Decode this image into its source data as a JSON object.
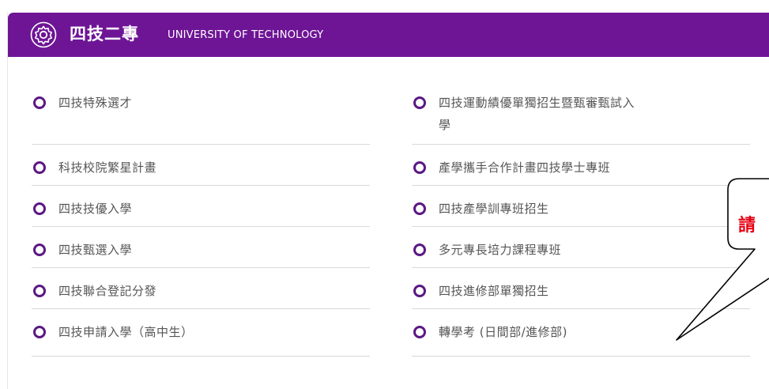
{
  "header": {
    "title": "四技二專",
    "subtitle": "UNIVERSITY OF TECHNOLOGY",
    "icon": "gear-settings-icon",
    "bg_color": "#6e1596"
  },
  "left_items": [
    {
      "label": "四技特殊選才"
    },
    {
      "label": "科技校院繁星計畫"
    },
    {
      "label": "四技技優入學"
    },
    {
      "label": "四技甄選入學"
    },
    {
      "label": "四技聯合登記分發"
    },
    {
      "label": "四技申請入學（高中生）"
    }
  ],
  "right_items": [
    {
      "label": "四技運動績優單獨招生暨甄審甄試入",
      "label2": "學"
    },
    {
      "label": "產學攜手合作計畫四技學士專班"
    },
    {
      "label": "四技產學訓專班招生"
    },
    {
      "label": "多元專長培力課程專班"
    },
    {
      "label": "四技進修部單獨招生"
    },
    {
      "label": "轉學考 (日間部/進修部)"
    }
  ],
  "callout": {
    "text": "請",
    "color": "#e60012"
  },
  "colors": {
    "accent": "#5b1883",
    "text": "#555555"
  }
}
